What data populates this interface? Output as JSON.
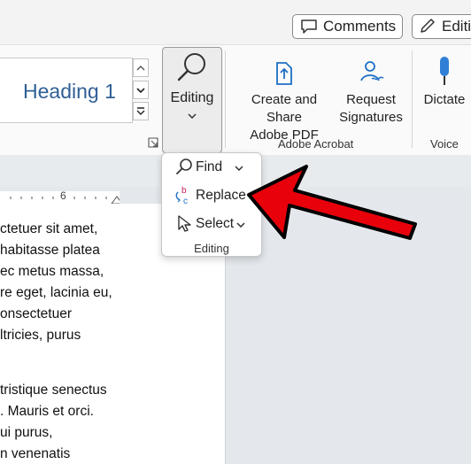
{
  "header": {
    "comments_label": "Comments",
    "editing_label": "Editin"
  },
  "ribbon": {
    "styles": {
      "current_style": "Heading 1"
    },
    "editing": {
      "label": "Editing"
    },
    "acrobat": {
      "create_share_line1": "Create and Share",
      "create_share_line2": "Adobe PDF",
      "request_line1": "Request",
      "request_line2": "Signatures",
      "group_label": "Adobe Acrobat"
    },
    "voice": {
      "dictate_label": "Dictate",
      "group_label": "Voice"
    }
  },
  "ruler": {
    "number": "6"
  },
  "editing_menu": {
    "items": [
      {
        "label": "Find",
        "icon": "search-icon"
      },
      {
        "label": "Replace",
        "icon": "replace-icon"
      },
      {
        "label": "Select",
        "icon": "cursor-icon"
      }
    ],
    "group_label": "Editing"
  },
  "document": {
    "lines": [
      "ctetuer sit amet,",
      "habitasse platea",
      "ec metus massa,",
      "re eget, lacinia eu,",
      "onsectetuer",
      "ltricies, purus",
      "",
      "tristique senectus",
      ". Mauris et orci.",
      "ui purus,",
      "n venenatis"
    ]
  },
  "annotation": {
    "arrow_color": "#e8000b"
  },
  "colors": {
    "heading_style": "#2f5f95",
    "acrobat_icon": "#1f6fc5"
  }
}
